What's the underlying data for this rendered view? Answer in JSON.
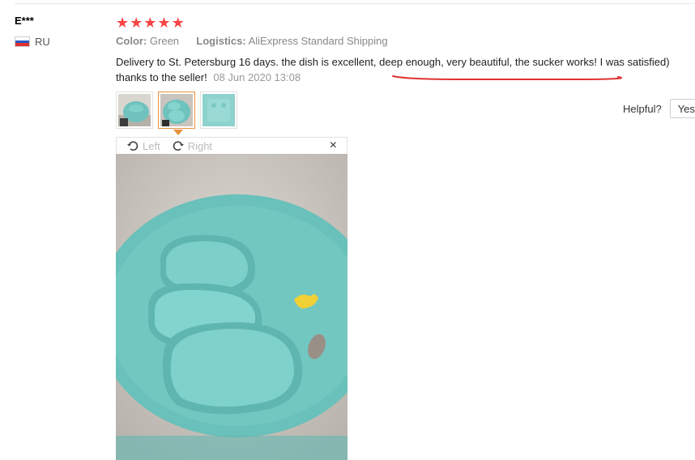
{
  "review": {
    "user": "E***",
    "country": "RU",
    "rating": 5,
    "stars": [
      "★",
      "★",
      "★",
      "★",
      "★"
    ],
    "color_label": "Color:",
    "color_value": "Green",
    "logistics_label": "Logistics:",
    "logistics_value": "AliExpress Standard Shipping",
    "text": "Delivery to St. Petersburg 16 days. the dish is excellent, deep enough, very beautiful, the sucker works! I was satisfied) thanks to the seller!",
    "date": "08 Jun 2020 13:08"
  },
  "helpful": {
    "label": "Helpful?",
    "yes": "Yes"
  },
  "viewer": {
    "rotate_left": "Left",
    "rotate_right": "Right",
    "close": "×"
  },
  "thumbnails": {
    "count": 3,
    "selected_index": 1
  },
  "colors": {
    "star": "#f84545",
    "accent_border": "#e8913f",
    "annotation_underline": "#e03131",
    "plate": "#6fc2bd"
  },
  "icons": {
    "rotate_left": "rotate-left-icon",
    "rotate_right": "rotate-right-icon",
    "close": "close-icon",
    "flag": "russia-flag-icon"
  }
}
